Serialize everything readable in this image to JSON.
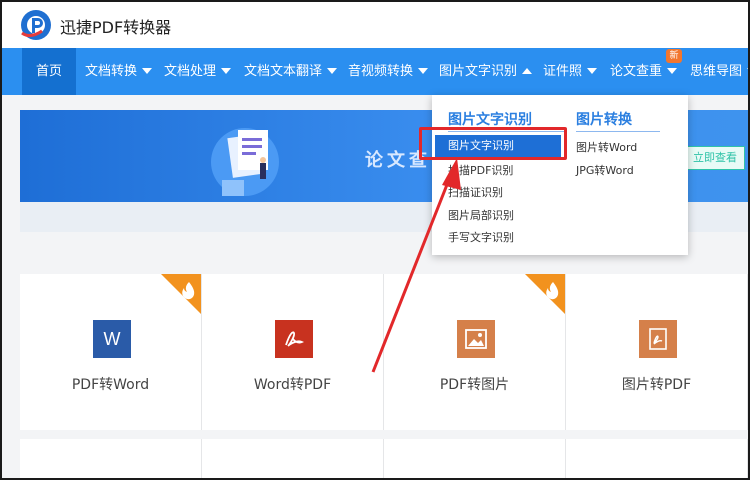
{
  "app": {
    "title": "迅捷PDF转换器"
  },
  "colors": {
    "nav": "#2b8ff0",
    "nav_active": "#1470d0",
    "accent": "#2b7fe0",
    "annotation": "#e2282a",
    "hot": "#f2921e"
  },
  "nav": {
    "items": [
      {
        "label": "首页",
        "caret": "none"
      },
      {
        "label": "文档转换",
        "caret": "down"
      },
      {
        "label": "文档处理",
        "caret": "down"
      },
      {
        "label": "文档文本翻译",
        "caret": "down"
      },
      {
        "label": "音视频转换",
        "caret": "down"
      },
      {
        "label": "图片文字识别",
        "caret": "up"
      },
      {
        "label": "证件照",
        "caret": "down"
      },
      {
        "label": "论文查重",
        "caret": "down"
      },
      {
        "label": "思维导图",
        "caret": "down"
      }
    ],
    "new_badge": "新"
  },
  "banner": {
    "text": "论文查",
    "button": "立即查看"
  },
  "dropdown": {
    "col1": {
      "title": "图片文字识别",
      "items": [
        "图片文字识别",
        "扫描PDF识别",
        "扫描证识别",
        "图片局部识别",
        "手写文字识别"
      ]
    },
    "col2": {
      "title": "图片转换",
      "items": [
        "图片转Word",
        "JPG转Word"
      ]
    }
  },
  "cards": [
    {
      "label": "PDF转Word",
      "icon": "word-icon",
      "color": "#2a5ba8",
      "hot": true
    },
    {
      "label": "Word转PDF",
      "icon": "pdf-icon",
      "color": "#c8321f",
      "hot": false
    },
    {
      "label": "PDF转图片",
      "icon": "image-icon",
      "color": "#d5804a",
      "hot": true
    },
    {
      "label": "图片转PDF",
      "icon": "pdf-icon",
      "color": "#d5804a",
      "hot": false
    }
  ]
}
